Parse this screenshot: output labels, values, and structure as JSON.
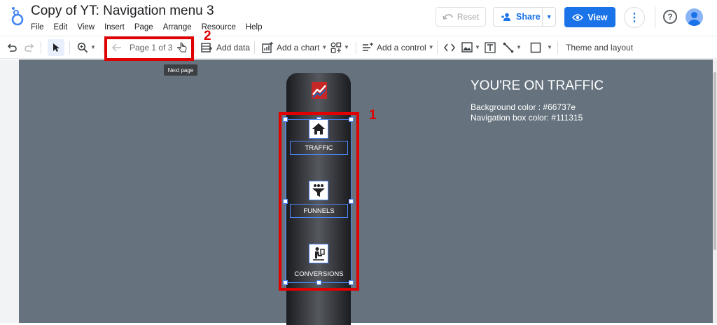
{
  "app": {
    "title": "Copy of YT: Navigation menu 3"
  },
  "menu": [
    "File",
    "Edit",
    "View",
    "Insert",
    "Page",
    "Arrange",
    "Resource",
    "Help"
  ],
  "header": {
    "reset_label": "Reset",
    "share_label": "Share",
    "view_label": "View"
  },
  "toolbar": {
    "page_label": "Page 1 of 3",
    "add_data_label": "Add data",
    "add_chart_label": "Add a chart",
    "add_control_label": "Add a control",
    "theme_label": "Theme and layout",
    "tooltip": "Next page"
  },
  "annotations": {
    "label_1": "1",
    "label_2": "2"
  },
  "report": {
    "heading": "YOU'RE ON TRAFFIC",
    "bg_info": "Background color : #66737e",
    "nav_info": "Navigation box color: #111315",
    "nav_items": [
      "TRAFFIC",
      "FUNNELS",
      "CONVERSIONS"
    ],
    "bg_color": "#66737e",
    "nav_color": "#111315"
  },
  "colors": {
    "accent": "#1a73e8",
    "annotation": "#e00000"
  }
}
